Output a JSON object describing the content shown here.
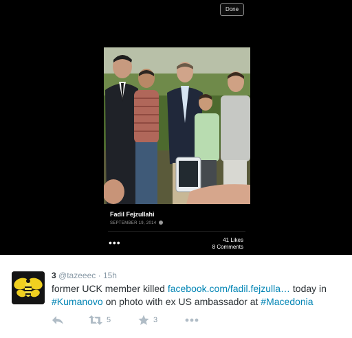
{
  "viewer": {
    "done_label": "Done",
    "photo_icon": "photo",
    "caption_name": "Fadil Fejzullahi",
    "caption_date": "SEPTEMBER 19, 2014",
    "globe_icon": "globe-icon",
    "more_icon": "ellipsis-icon",
    "likes": "41 Likes",
    "comments": "8 Comments"
  },
  "tweet": {
    "avatar_icon": "bee-icon",
    "name": "3",
    "handle": "@tazeeec",
    "separator": "·",
    "time": "15h",
    "text_pre": "former UCK member killed ",
    "link": "facebook.com/fadil.fejzulla…",
    "text_mid": " today in ",
    "hashtag_1": "#Kumanovo",
    "text_mid2": " on photo with ex US ambassador at ",
    "hashtag_2": "#Macedonia",
    "retweet_count": "5",
    "favorite_count": "3"
  },
  "colors": {
    "viewer_bg": "#000000",
    "link": "#0084b4",
    "text": "#292f33",
    "muted": "#8899a6",
    "action_icon": "#b0bcc6"
  }
}
